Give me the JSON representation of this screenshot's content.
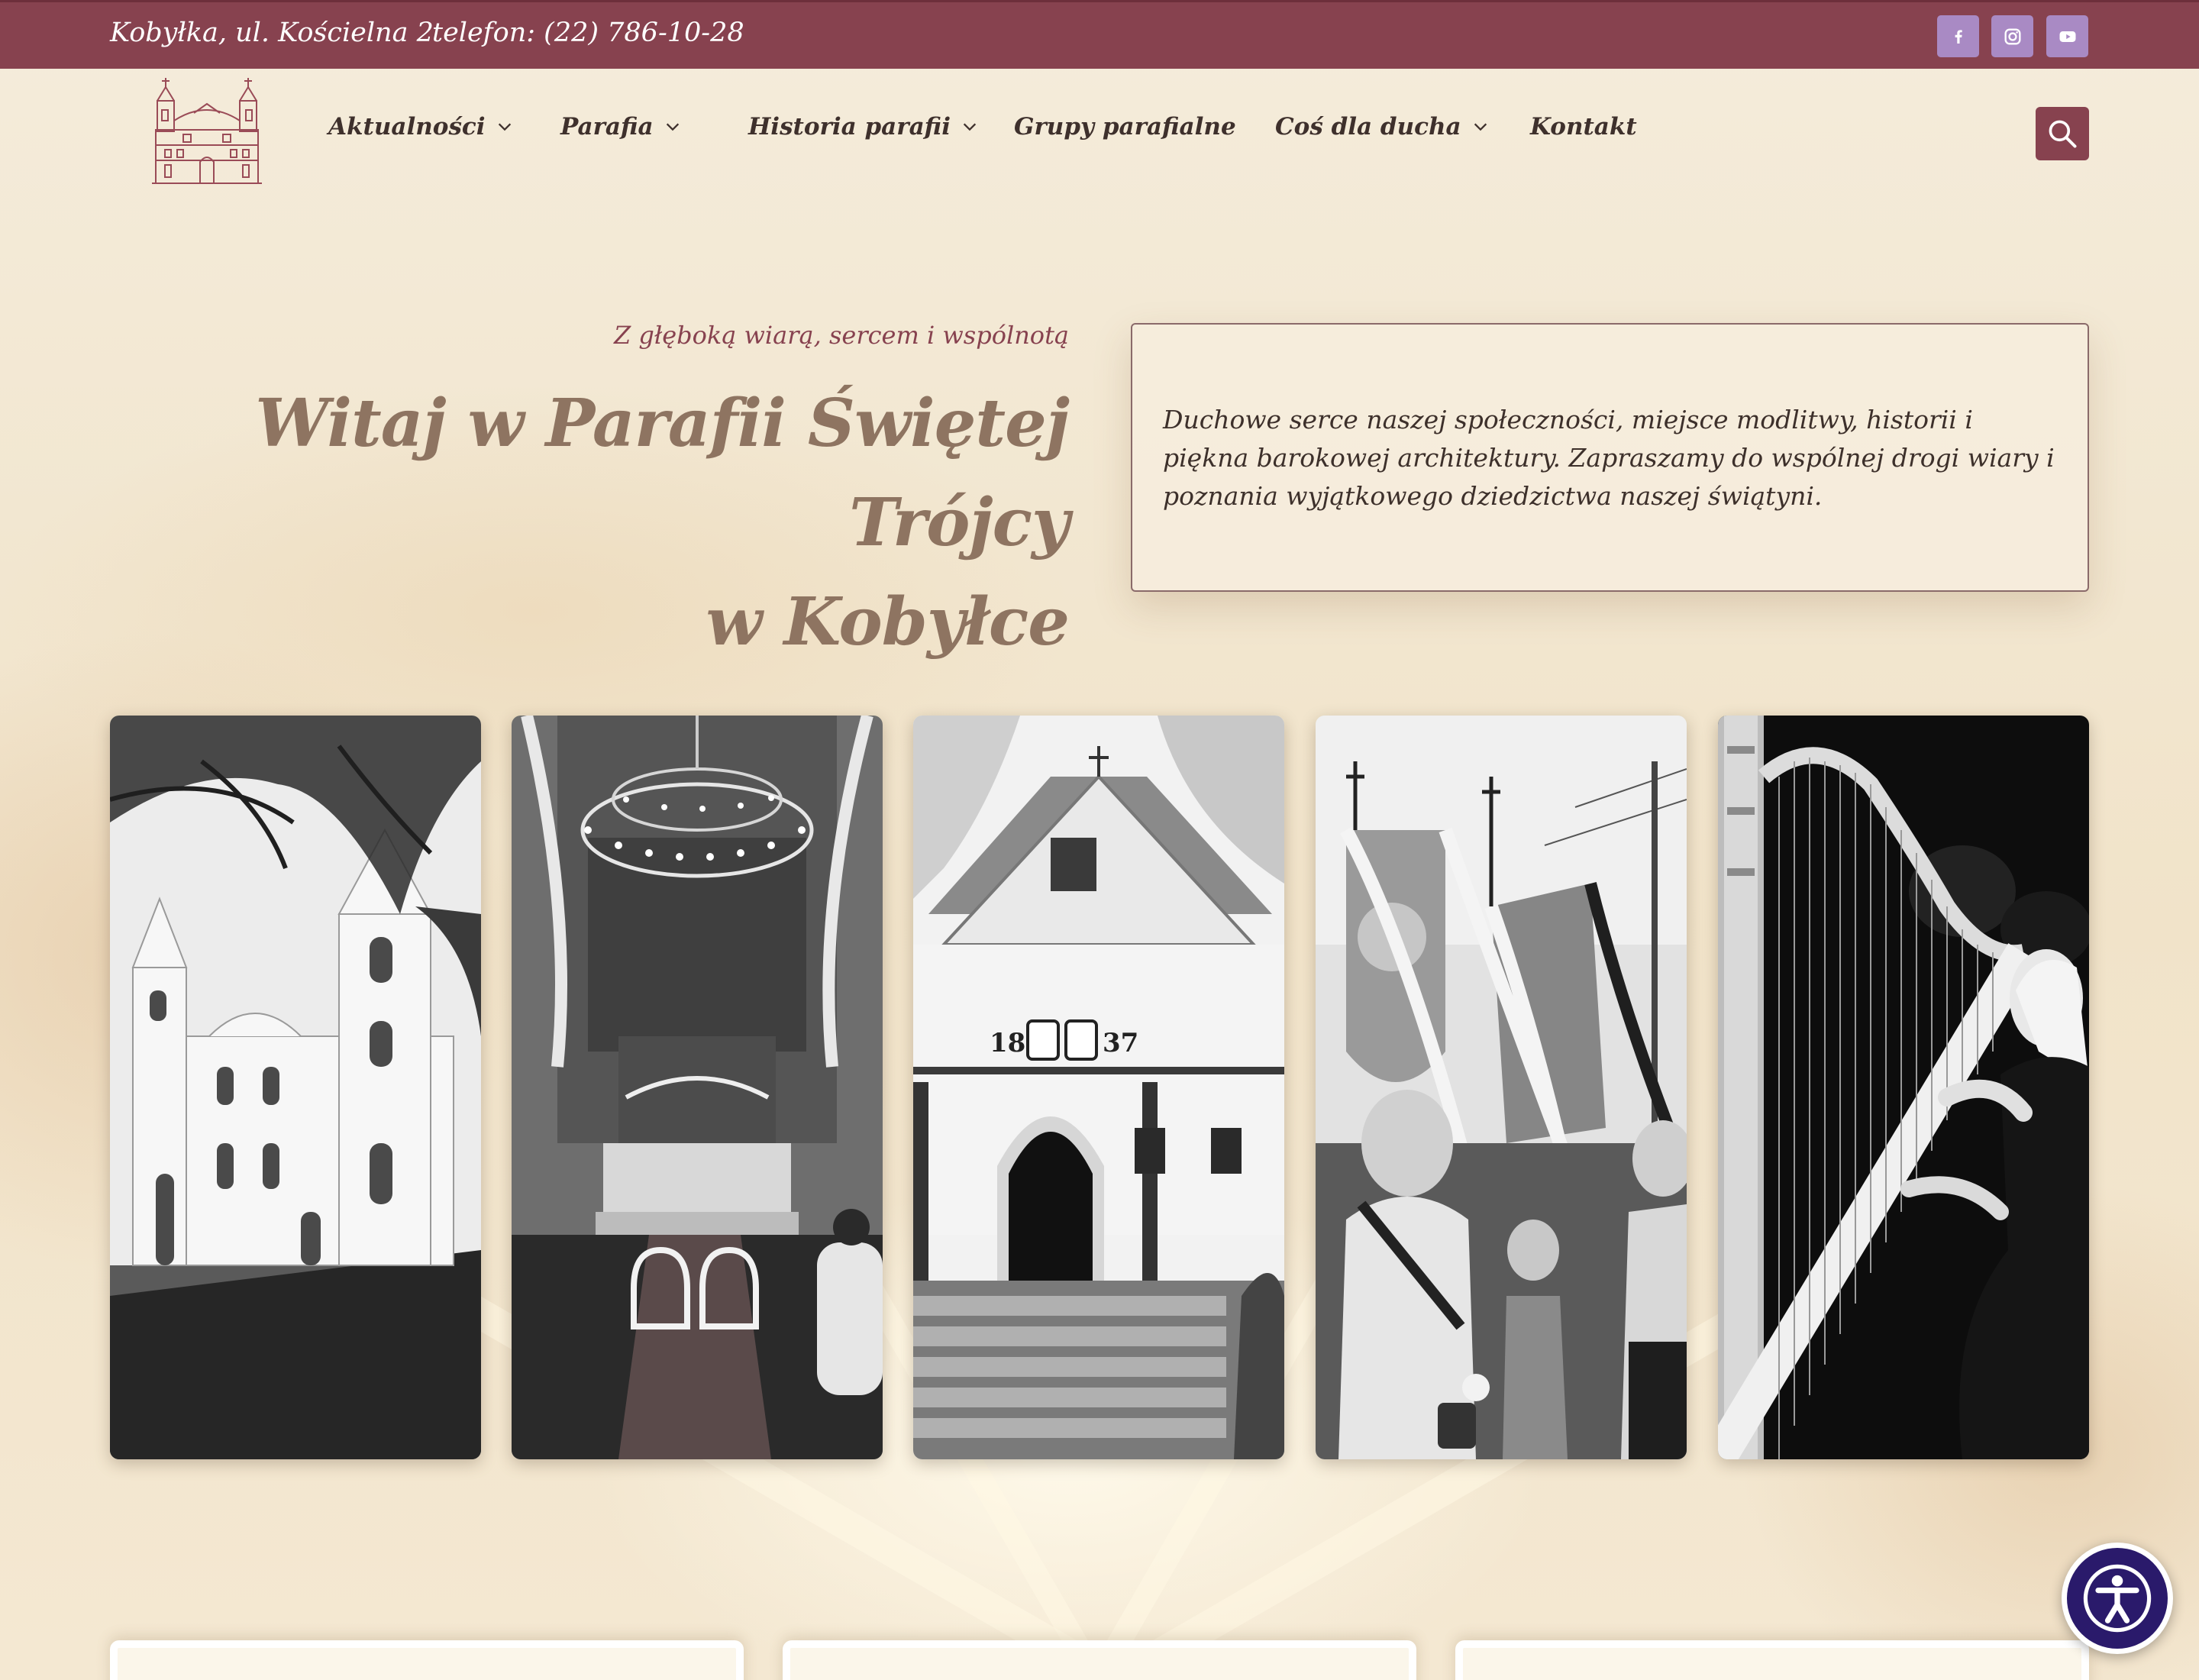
{
  "topbar": {
    "address": "Kobyłka, ul. Kościelna 2",
    "phone": "telefon: (22) 786-10-28",
    "social": [
      "facebook-icon",
      "instagram-icon",
      "youtube-icon"
    ]
  },
  "nav": {
    "items": [
      {
        "label": "Aktualności",
        "has_dropdown": true
      },
      {
        "label": "Parafia",
        "has_dropdown": true
      },
      {
        "label": "Historia parafii",
        "has_dropdown": true
      },
      {
        "label": "Grupy parafialne",
        "has_dropdown": false
      },
      {
        "label": "Coś dla ducha",
        "has_dropdown": true
      },
      {
        "label": "Kontakt",
        "has_dropdown": false
      }
    ]
  },
  "hero": {
    "tagline": "Z głęboką wiarą, sercem i wspólnotą",
    "title_line1": "Witaj w Parafii Świętej Trójcy",
    "title_line2": "w Kobyłce",
    "intro": "Duchowe serce naszej społeczności, miejsce modlitwy, historii i piękna barokowej architektury. Zapraszamy do wspólnej drogi wiary i poznania wyjątkowego dziedzictwa naszej świątyni."
  },
  "gallery": {
    "photos": [
      "church-exterior-photo",
      "church-altar-photo",
      "chapel-1837-photo",
      "procession-photo",
      "harp-concert-photo"
    ],
    "chapel_inscription_left": "18",
    "chapel_inscription_right": "37"
  },
  "colors": {
    "brand": "#87424f",
    "title": "#8e7461",
    "social": "#a98ac4",
    "background": "#f3e9d4"
  }
}
